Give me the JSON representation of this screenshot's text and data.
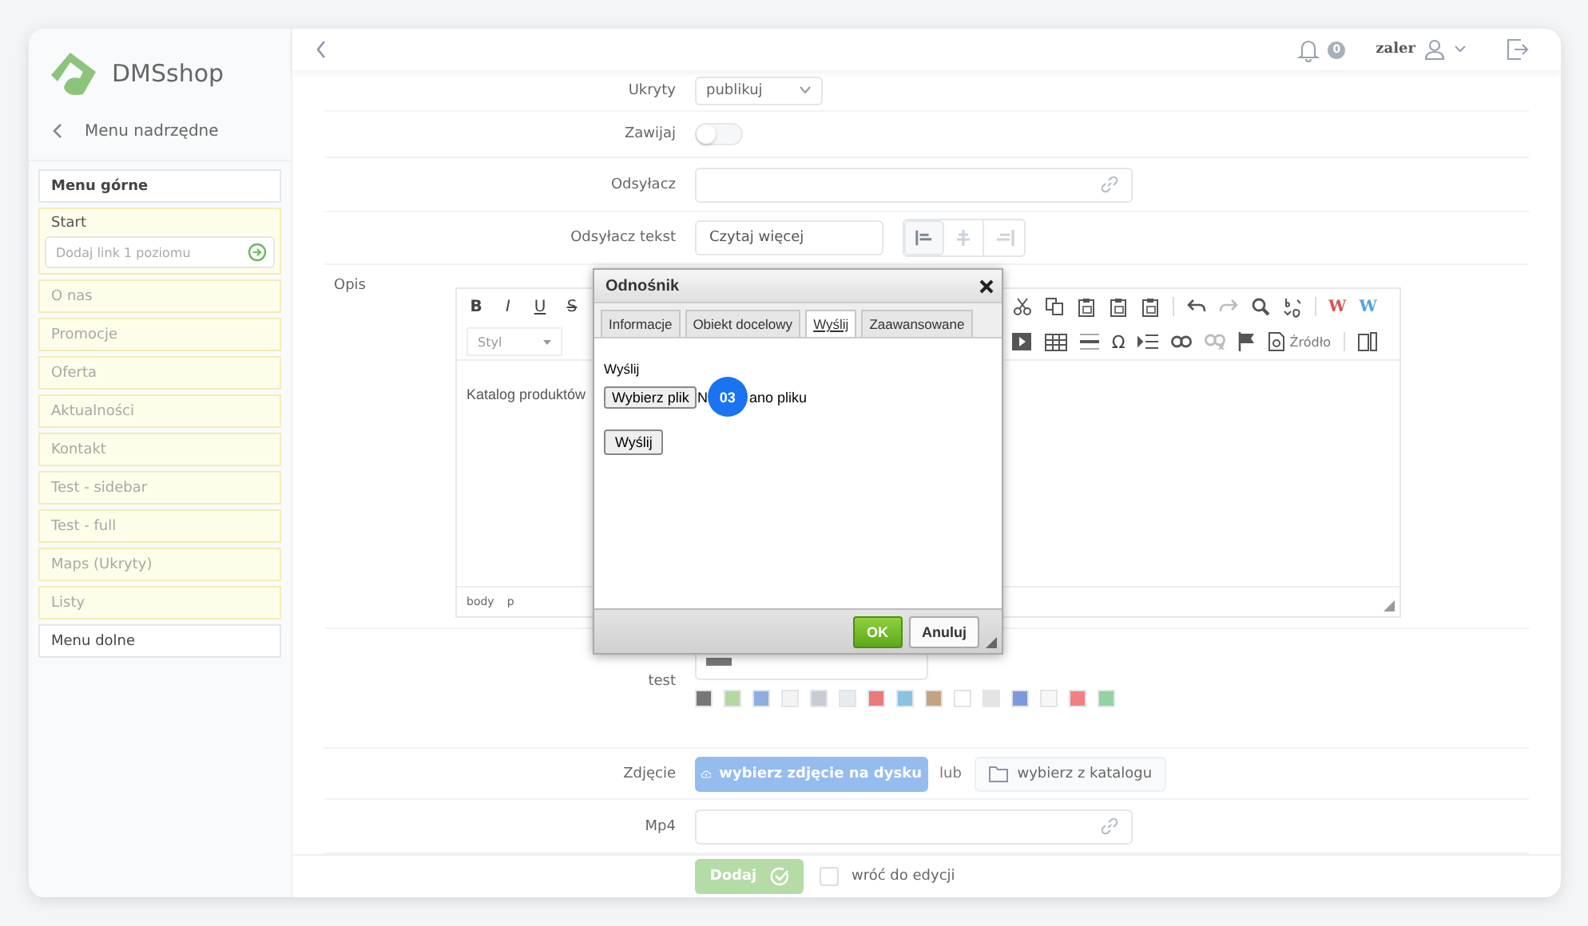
{
  "sidebar": {
    "logo": "DMSshop",
    "back": "Menu nadrzędne",
    "items": [
      {
        "kind": "header",
        "label": "Menu górne"
      },
      {
        "kind": "link",
        "label": "Start",
        "expanded": true,
        "add_placeholder": "Dodaj link 1 poziomu"
      },
      {
        "kind": "link",
        "label": "O nas",
        "expanded": false
      },
      {
        "kind": "link",
        "label": "Promocje",
        "expanded": false
      },
      {
        "kind": "link",
        "label": "Oferta",
        "expanded": false
      },
      {
        "kind": "link",
        "label": "Aktualności",
        "expanded": false
      },
      {
        "kind": "link",
        "label": "Kontakt",
        "expanded": false
      },
      {
        "kind": "link",
        "label": "Test - sidebar",
        "expanded": false
      },
      {
        "kind": "link",
        "label": "Test - full",
        "expanded": false
      },
      {
        "kind": "link",
        "label": "Maps (Ukryty)",
        "expanded": false
      },
      {
        "kind": "link",
        "label": "Listy",
        "expanded": false
      },
      {
        "kind": "header",
        "label": "Menu dolne"
      }
    ]
  },
  "topbar": {
    "notifications": "0",
    "user": "zaler"
  },
  "form": {
    "rows": [
      {
        "kind": "select",
        "label": "Ukryty",
        "value": "publikuj"
      },
      {
        "kind": "toggle",
        "label": "Zawijaj",
        "on": false
      },
      {
        "kind": "link",
        "label": "Odsyłacz"
      },
      {
        "kind": "text-align",
        "label": "Odsyłacz tekst",
        "value": "Czytaj więcej",
        "alignments": [
          {
            "selected": true
          },
          {
            "selected": false
          },
          {
            "selected": false
          }
        ]
      },
      {
        "kind": "editor",
        "label": "Opis",
        "format_buttons": [
          "B",
          "I",
          "U",
          "S"
        ],
        "style_placeholder": "Styl",
        "word_buttons": [
          "W",
          "W"
        ],
        "omega": "Ω",
        "source": "Źródło",
        "content": "Katalog produktów",
        "path": [
          "body",
          "p"
        ]
      },
      {
        "kind": "color",
        "label": "test",
        "color": "#777777",
        "swatches": [
          {
            "color": "#777777"
          },
          {
            "color": "#b5d8a0"
          },
          {
            "color": "#8eaee0"
          },
          {
            "color": "#f3f3f3"
          },
          {
            "color": "#c8ccd6"
          },
          {
            "color": "#e8ebf0"
          },
          {
            "color": "#e97a7a"
          },
          {
            "color": "#88c3e0"
          },
          {
            "color": "#c4a381"
          },
          {
            "color": "#ffffff"
          },
          {
            "color": "#e4e4e4"
          },
          {
            "color": "#7d99dd"
          },
          {
            "color": "#f7f7f7"
          },
          {
            "color": "#f28080"
          },
          {
            "color": "#92d3a0"
          }
        ]
      },
      {
        "kind": "photo",
        "label": "Zdjęcie",
        "upload": "wybierz zdjęcie na dysku",
        "or": "lub",
        "catalog": "wybierz z katalogu"
      },
      {
        "kind": "link",
        "label": "Mp4"
      }
    ]
  },
  "footer": {
    "submit": "Dodaj",
    "return_label": "wróć do edycji",
    "return_checked": false
  },
  "dialog": {
    "title": "Odnośnik",
    "tabs": [
      {
        "label": "Informacje",
        "selected": false
      },
      {
        "label": "Obiekt docelowy",
        "selected": false
      },
      {
        "label": "Wyślij",
        "selected": true
      },
      {
        "label": "Zaawansowane",
        "selected": false
      }
    ],
    "upload_label": "Wyślij",
    "file_button": "Wybierz plik",
    "file_status_before": "N",
    "step_badge": "03",
    "file_status_after": "ano pliku",
    "send_button": "Wyślij",
    "ok": "OK",
    "cancel": "Anuluj"
  }
}
